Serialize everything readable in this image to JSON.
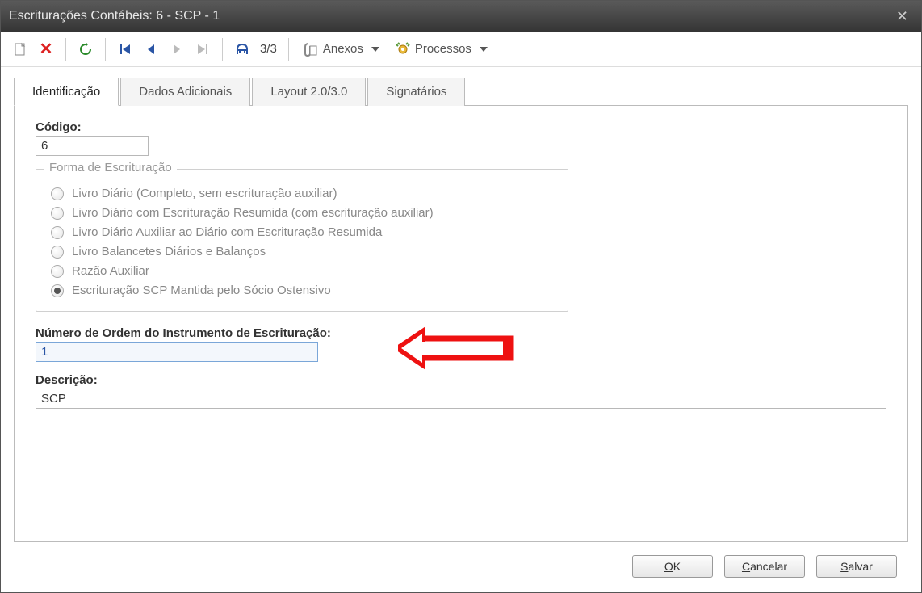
{
  "window": {
    "title": "Escriturações Contábeis: 6 - SCP - 1"
  },
  "toolbar": {
    "record_counter": "3/3",
    "anexos_label": "Anexos",
    "processos_label": "Processos"
  },
  "tabs": [
    {
      "label": "Identificação",
      "active": true
    },
    {
      "label": "Dados Adicionais",
      "active": false
    },
    {
      "label": "Layout 2.0/3.0",
      "active": false
    },
    {
      "label": "Signatários",
      "active": false
    }
  ],
  "form": {
    "codigo_label": "Código:",
    "codigo_value": "6",
    "fieldset_title": "Forma de Escrituração",
    "radios": [
      {
        "label": "Livro Diário (Completo, sem escrituração auxiliar)",
        "selected": false
      },
      {
        "label": "Livro Diário com Escrituração Resumida (com escrituração auxiliar)",
        "selected": false
      },
      {
        "label": "Livro Diário Auxiliar ao Diário com Escrituração Resumida",
        "selected": false
      },
      {
        "label": "Livro Balancetes Diários e Balanços",
        "selected": false
      },
      {
        "label": "Razão Auxiliar",
        "selected": false
      },
      {
        "label": "Escrituração SCP Mantida pelo Sócio Ostensivo",
        "selected": true
      }
    ],
    "numordem_label": "Número de Ordem do Instrumento de Escrituração:",
    "numordem_value": "1",
    "descricao_label": "Descrição:",
    "descricao_value": "SCP"
  },
  "buttons": {
    "ok": "OK",
    "cancelar": "Cancelar",
    "salvar": "Salvar"
  }
}
